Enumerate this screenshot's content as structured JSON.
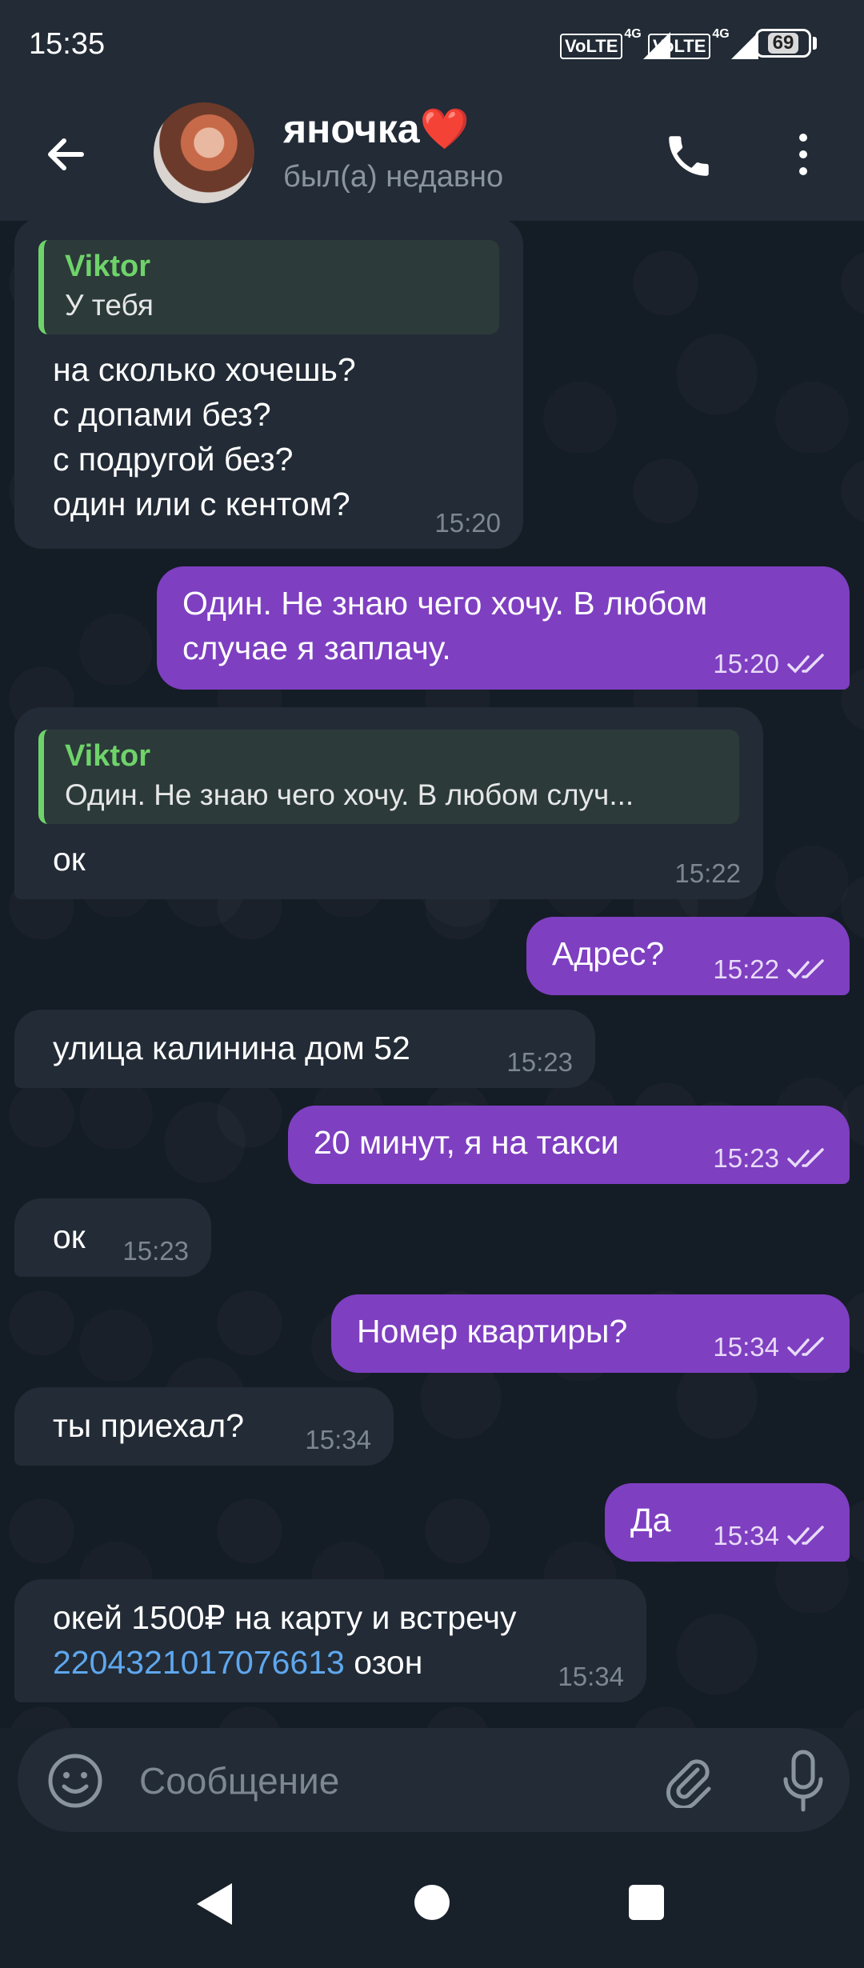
{
  "status_bar": {
    "time": "15:35",
    "network1": "VoLTE",
    "network1_gen": "4G",
    "network2": "VoLTE",
    "network2_gen": "4G",
    "battery": "69"
  },
  "header": {
    "contact_name": "яночка❤️",
    "contact_status": "был(а) недавно",
    "back_icon": "arrow-left-icon",
    "call_icon": "phone-icon",
    "menu_icon": "more-vertical-icon"
  },
  "messages": [
    {
      "dir": "in",
      "reply_author": "Viktor",
      "reply_text": "У тебя",
      "text": "на сколько хочешь?\nс допами без?\nс подругой без?\nодин или с кентом?",
      "time": "15:20"
    },
    {
      "dir": "out",
      "text": "Один. Не знаю чего хочу. В любом\nслучае я заплачу.",
      "time": "15:20",
      "status": "read"
    },
    {
      "dir": "in",
      "reply_author": "Viktor",
      "reply_text": "Один. Не знаю чего хочу. В любом случ...",
      "text": "ок",
      "time": "15:22"
    },
    {
      "dir": "out",
      "text": "Адрес?",
      "time": "15:22",
      "status": "read"
    },
    {
      "dir": "in",
      "text": "улица калинина дом 52",
      "time": "15:23"
    },
    {
      "dir": "out",
      "text": "20 минут, я на такси",
      "time": "15:23",
      "status": "read"
    },
    {
      "dir": "in",
      "text": "ок",
      "time": "15:23"
    },
    {
      "dir": "out",
      "text": "Номер квартиры?",
      "time": "15:34",
      "status": "read"
    },
    {
      "dir": "in",
      "text": "ты приехал?",
      "time": "15:34"
    },
    {
      "dir": "out",
      "text": "Да",
      "time": "15:34",
      "status": "read"
    },
    {
      "dir": "in",
      "text_line1": "окей 1500₽ на карту и встречу",
      "text_link": "2204321017076613",
      "text_after": " озон",
      "time": "15:34"
    }
  ],
  "composer": {
    "placeholder": "Сообщение",
    "emoji_icon": "emoji-icon",
    "attach_icon": "paperclip-icon",
    "mic_icon": "microphone-icon"
  },
  "colors": {
    "incoming_bubble": "#222b36",
    "outgoing_bubble": "#7e3fc1",
    "reply_accent": "#6fd36a",
    "link": "#5fa7ee"
  }
}
